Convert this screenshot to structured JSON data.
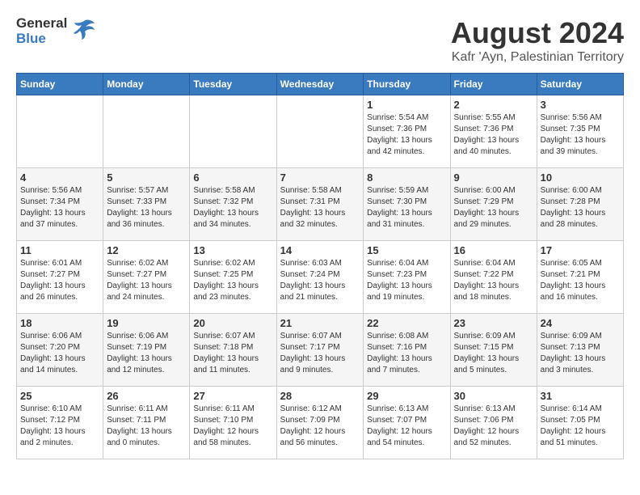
{
  "header": {
    "logo_general": "General",
    "logo_blue": "Blue",
    "main_title": "August 2024",
    "subtitle": "Kafr 'Ayn, Palestinian Territory"
  },
  "calendar": {
    "days_of_week": [
      "Sunday",
      "Monday",
      "Tuesday",
      "Wednesday",
      "Thursday",
      "Friday",
      "Saturday"
    ],
    "weeks": [
      [
        {
          "day": "",
          "info": ""
        },
        {
          "day": "",
          "info": ""
        },
        {
          "day": "",
          "info": ""
        },
        {
          "day": "",
          "info": ""
        },
        {
          "day": "1",
          "info": "Sunrise: 5:54 AM\nSunset: 7:36 PM\nDaylight: 13 hours\nand 42 minutes."
        },
        {
          "day": "2",
          "info": "Sunrise: 5:55 AM\nSunset: 7:36 PM\nDaylight: 13 hours\nand 40 minutes."
        },
        {
          "day": "3",
          "info": "Sunrise: 5:56 AM\nSunset: 7:35 PM\nDaylight: 13 hours\nand 39 minutes."
        }
      ],
      [
        {
          "day": "4",
          "info": "Sunrise: 5:56 AM\nSunset: 7:34 PM\nDaylight: 13 hours\nand 37 minutes."
        },
        {
          "day": "5",
          "info": "Sunrise: 5:57 AM\nSunset: 7:33 PM\nDaylight: 13 hours\nand 36 minutes."
        },
        {
          "day": "6",
          "info": "Sunrise: 5:58 AM\nSunset: 7:32 PM\nDaylight: 13 hours\nand 34 minutes."
        },
        {
          "day": "7",
          "info": "Sunrise: 5:58 AM\nSunset: 7:31 PM\nDaylight: 13 hours\nand 32 minutes."
        },
        {
          "day": "8",
          "info": "Sunrise: 5:59 AM\nSunset: 7:30 PM\nDaylight: 13 hours\nand 31 minutes."
        },
        {
          "day": "9",
          "info": "Sunrise: 6:00 AM\nSunset: 7:29 PM\nDaylight: 13 hours\nand 29 minutes."
        },
        {
          "day": "10",
          "info": "Sunrise: 6:00 AM\nSunset: 7:28 PM\nDaylight: 13 hours\nand 28 minutes."
        }
      ],
      [
        {
          "day": "11",
          "info": "Sunrise: 6:01 AM\nSunset: 7:27 PM\nDaylight: 13 hours\nand 26 minutes."
        },
        {
          "day": "12",
          "info": "Sunrise: 6:02 AM\nSunset: 7:27 PM\nDaylight: 13 hours\nand 24 minutes."
        },
        {
          "day": "13",
          "info": "Sunrise: 6:02 AM\nSunset: 7:25 PM\nDaylight: 13 hours\nand 23 minutes."
        },
        {
          "day": "14",
          "info": "Sunrise: 6:03 AM\nSunset: 7:24 PM\nDaylight: 13 hours\nand 21 minutes."
        },
        {
          "day": "15",
          "info": "Sunrise: 6:04 AM\nSunset: 7:23 PM\nDaylight: 13 hours\nand 19 minutes."
        },
        {
          "day": "16",
          "info": "Sunrise: 6:04 AM\nSunset: 7:22 PM\nDaylight: 13 hours\nand 18 minutes."
        },
        {
          "day": "17",
          "info": "Sunrise: 6:05 AM\nSunset: 7:21 PM\nDaylight: 13 hours\nand 16 minutes."
        }
      ],
      [
        {
          "day": "18",
          "info": "Sunrise: 6:06 AM\nSunset: 7:20 PM\nDaylight: 13 hours\nand 14 minutes."
        },
        {
          "day": "19",
          "info": "Sunrise: 6:06 AM\nSunset: 7:19 PM\nDaylight: 13 hours\nand 12 minutes."
        },
        {
          "day": "20",
          "info": "Sunrise: 6:07 AM\nSunset: 7:18 PM\nDaylight: 13 hours\nand 11 minutes."
        },
        {
          "day": "21",
          "info": "Sunrise: 6:07 AM\nSunset: 7:17 PM\nDaylight: 13 hours\nand 9 minutes."
        },
        {
          "day": "22",
          "info": "Sunrise: 6:08 AM\nSunset: 7:16 PM\nDaylight: 13 hours\nand 7 minutes."
        },
        {
          "day": "23",
          "info": "Sunrise: 6:09 AM\nSunset: 7:15 PM\nDaylight: 13 hours\nand 5 minutes."
        },
        {
          "day": "24",
          "info": "Sunrise: 6:09 AM\nSunset: 7:13 PM\nDaylight: 13 hours\nand 3 minutes."
        }
      ],
      [
        {
          "day": "25",
          "info": "Sunrise: 6:10 AM\nSunset: 7:12 PM\nDaylight: 13 hours\nand 2 minutes."
        },
        {
          "day": "26",
          "info": "Sunrise: 6:11 AM\nSunset: 7:11 PM\nDaylight: 13 hours\nand 0 minutes."
        },
        {
          "day": "27",
          "info": "Sunrise: 6:11 AM\nSunset: 7:10 PM\nDaylight: 12 hours\nand 58 minutes."
        },
        {
          "day": "28",
          "info": "Sunrise: 6:12 AM\nSunset: 7:09 PM\nDaylight: 12 hours\nand 56 minutes."
        },
        {
          "day": "29",
          "info": "Sunrise: 6:13 AM\nSunset: 7:07 PM\nDaylight: 12 hours\nand 54 minutes."
        },
        {
          "day": "30",
          "info": "Sunrise: 6:13 AM\nSunset: 7:06 PM\nDaylight: 12 hours\nand 52 minutes."
        },
        {
          "day": "31",
          "info": "Sunrise: 6:14 AM\nSunset: 7:05 PM\nDaylight: 12 hours\nand 51 minutes."
        }
      ]
    ]
  }
}
